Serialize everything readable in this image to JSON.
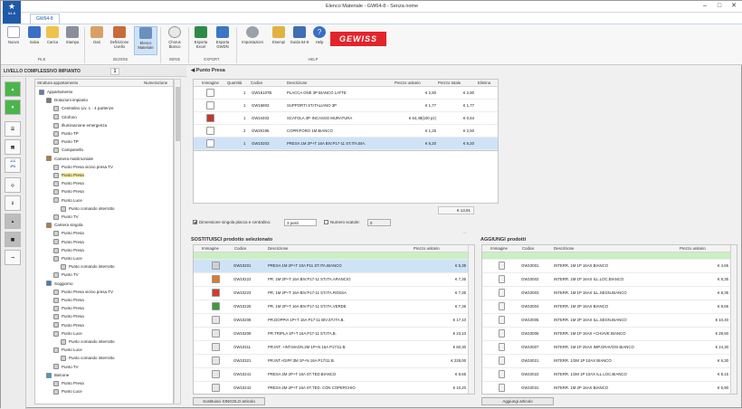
{
  "window": {
    "title": "Elenco Materiale - GW64-8 - Senza nome",
    "app_badge": "64-8",
    "tab": "GW64-8"
  },
  "ribbon": {
    "buttons": [
      {
        "label": "Nuovo"
      },
      {
        "label": "Salva"
      },
      {
        "label": "Carica"
      },
      {
        "label": "Stampa"
      },
      {
        "label": "Dati"
      },
      {
        "label": "Definizione Livello"
      },
      {
        "label": "Elenco Materiale"
      },
      {
        "label": "Chorus Bianco"
      },
      {
        "label": "Esporta Excel"
      },
      {
        "label": "Esporta GWDN"
      },
      {
        "label": "Impostazioni"
      },
      {
        "label": "Esempi"
      },
      {
        "label": "Guida 64-8"
      },
      {
        "label": "Help"
      }
    ],
    "groups": {
      "file": "FILE",
      "sezioni": "SEZIONI",
      "serie": "SERIE",
      "export": "EXPORT",
      "help": "HELP"
    },
    "brand": "GEWISS"
  },
  "left": {
    "level_label": "LIVELLO COMPLESSIVO IMPIANTO",
    "level_value": "1",
    "tool_labels": {
      "l1p1": "-L1\n-P1"
    }
  },
  "tree": {
    "col_structure": "Struttura appartamento",
    "col_numbering": "Numerazione",
    "rows": [
      {
        "label": "Appartamento"
      },
      {
        "label": "Dotazioni impianto"
      },
      {
        "label": "Centralino Liv. 1 - 4 partenze"
      },
      {
        "label": "Citofono"
      },
      {
        "label": "Illuminazione emergenza"
      },
      {
        "label": "Punto TP"
      },
      {
        "label": "Punto TP"
      },
      {
        "label": "Campanello"
      },
      {
        "label": "Camera matrimoniale"
      },
      {
        "label": "Punto Presa vicino presa TV"
      },
      {
        "label": "Punto Presa"
      },
      {
        "label": "Punto Presa"
      },
      {
        "label": "Punto Presa"
      },
      {
        "label": "Punto Luce"
      },
      {
        "label": "Punto comando interrotto"
      },
      {
        "label": "Punto TV"
      },
      {
        "label": "Camera singola"
      },
      {
        "label": "Punto Presa"
      },
      {
        "label": "Punto Presa"
      },
      {
        "label": "Punto Presa"
      },
      {
        "label": "Punto Luce"
      },
      {
        "label": "Punto comando interrotto"
      },
      {
        "label": "Punto TV"
      },
      {
        "label": "Soggiorno"
      },
      {
        "label": "Punto Presa vicino presa TV"
      },
      {
        "label": "Punto Presa"
      },
      {
        "label": "Punto Presa"
      },
      {
        "label": "Punto Presa"
      },
      {
        "label": "Punto Presa"
      },
      {
        "label": "Punto Luce"
      },
      {
        "label": "Punto comando interrotto"
      },
      {
        "label": "Punto Luce"
      },
      {
        "label": "Punto comando interrotto"
      },
      {
        "label": "Punto TV"
      },
      {
        "label": "Balcone"
      },
      {
        "label": "Punto Presa"
      },
      {
        "label": "Punto Luce"
      }
    ]
  },
  "punto_presa": {
    "title": "Punto Presa",
    "columns": [
      "Immagine",
      "Quantità",
      "Codice",
      "Descrizione",
      "Prezzo unitario",
      "Prezzo totale",
      "Elimina"
    ],
    "rows": [
      {
        "qty": "1",
        "code": "GW16107B",
        "desc": "PLACCA ONE 3P BIANCO LATTE",
        "unit": "€ 2,80",
        "total": "€ 2,80"
      },
      {
        "qty": "1",
        "code": "GW16803",
        "desc": "SUPPORTI ST.ITALIANO 3P",
        "unit": "€ 1,77",
        "total": "€ 1,77"
      },
      {
        "qty": "1",
        "code": "GW24403",
        "desc": "SCATOLA 3P. INCASSO MURATURA",
        "unit": "€ 64,48(100 pz)",
        "total": "€ 0,64"
      },
      {
        "qty": "2",
        "code": "GW20195",
        "desc": "COPRIFORO 1M BIANCO",
        "unit": "€ 1,25",
        "total": "€ 2,50"
      },
      {
        "qty": "1",
        "code": "GW10203",
        "desc": "PRESA 1M 2P+T 16A BIV.P17-11 ST.ITA.BIA.",
        "unit": "€ 6,20",
        "total": "€ 6,20"
      }
    ],
    "total": "€ 13,91",
    "option_dimension_label": "Dimensione singola placca e centralino:",
    "option_dimension_value": "3 posti",
    "option_numero_label": "Numero scatole:",
    "option_numero_value": "0"
  },
  "sostituisci": {
    "title": "SOSTITUISCI prodotto selezionato",
    "columns": [
      "Immagine",
      "Codice",
      "Descrizione",
      "Prezzo unitario"
    ],
    "rows": [
      {
        "code": "GW10201",
        "desc": "PRESA 1M 2P+T 10A P11 ST.ITA.BIANCO",
        "price": "€ 5,35",
        "color": "#cfcfcf"
      },
      {
        "code": "GW10222",
        "desc": "PR. 1M 2P+T 16A BIV.P17-11 ST.ITA.ARANCIO",
        "price": "€ 7,35",
        "color": "#e07a2a"
      },
      {
        "code": "GW10223",
        "desc": "PR. 1M 2P+T 16A BIV.P17-11 ST.ITA.ROSSA",
        "price": "€ 7,35",
        "color": "#d23b2c"
      },
      {
        "code": "GW10225",
        "desc": "PR. 1M 2P+T 16A BIV.P17-11 ST.ITA.VERDE",
        "price": "€ 7,35",
        "color": "#3c9a3c"
      },
      {
        "code": "GW10208",
        "desc": "PR.DOPPIA 1P+T 16A P17-11 BIV.ST.ITA.B.",
        "price": "€ 17,10",
        "color": "#e6e6e6"
      },
      {
        "code": "GW10209",
        "desc": "PR.TRIPLA 1P+T 16A P17-11 ST.ITA.B.",
        "price": "€ 23,10",
        "color": "#e6e6e6"
      },
      {
        "code": "GW10311",
        "desc": "PR.INT. +INT.MAGN.2M 1P+N 16A P17/11 B.",
        "price": "€ 60,30",
        "color": "#e6e6e6"
      },
      {
        "code": "GW10321",
        "desc": "PR.INT.+DIFF.3M 1P+N 16A P17/11 B.",
        "price": "€ 228,00",
        "color": "#e6e6e6"
      },
      {
        "code": "GW10241",
        "desc": "PRESA 2M 2P+T 16A ST.TED.BIANCO",
        "price": "€ 8,65",
        "color": "#e6e6e6"
      },
      {
        "code": "GW10242",
        "desc": "PRESA 2M 2P+T 16A ST.TED. CON COPERCHIO",
        "price": "€ 10,20",
        "color": "#e6e6e6"
      }
    ],
    "button": "Sostituisci SINGOLO articolo"
  },
  "aggiungi": {
    "title": "AGGIUNGI prodotti",
    "columns": [
      "Immagine",
      "Codice",
      "Descrizione",
      "Prezzo unitario"
    ],
    "rows": [
      {
        "code": "GW10001",
        "desc": "INTERR. 1M 1P 16AX BIANCO",
        "price": "€ 4,65"
      },
      {
        "code": "GW10002",
        "desc": "INTERR. 1M 1P 16AX ILL.LOC.BIANCO",
        "price": "€ 8,35"
      },
      {
        "code": "GW10003",
        "desc": "INTERR. 1M 1P 16AX ILL.SEGN.BIANCO",
        "price": "€ 8,35"
      },
      {
        "code": "GW10004",
        "desc": "INTERR. 1M 2P 16AX BIANCO",
        "price": "€ 9,65"
      },
      {
        "code": "GW10005",
        "desc": "INTERR. 1M 2P 16AX ILL.SEGN.BIANCO",
        "price": "€ 10,40"
      },
      {
        "code": "GW10006",
        "desc": "INTERR. 1M 1P 16AX +CHIAVE BIANCO",
        "price": "€ 29,60"
      },
      {
        "code": "GW10007",
        "desc": "INTERR. 1M 1P 25AX IMP.GRAVOSI BIANCO",
        "price": "€ 24,30"
      },
      {
        "code": "GW10021",
        "desc": "INTERR. 1/2M 1P 10AX BIANCO",
        "price": "€ 6,30"
      },
      {
        "code": "GW10022",
        "desc": "INTERR. 1/2M 1P 10AX ILL.LOC.BIANCO",
        "price": "€ 8,15"
      },
      {
        "code": "GW10031",
        "desc": "INTERR. 1M 2P 16AX BIANCO",
        "price": "€ 6,90"
      }
    ],
    "button": "Aggiungi articolo"
  }
}
